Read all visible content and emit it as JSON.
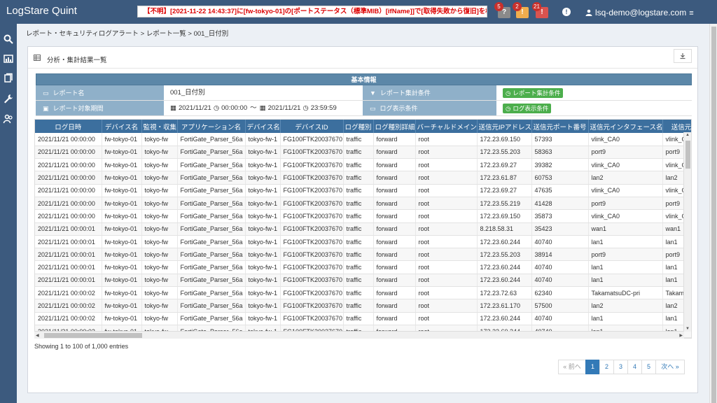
{
  "app": {
    "title": "LogStare Quint",
    "alert": "【不明】[2021-11-22 14:43:37]に[fw-tokyo-01]の[ポートステータス（標準MIB）[ifName]]で[取得失敗から復旧]を検知し",
    "user": "lsq-demo@logstare.com"
  },
  "notifications": [
    {
      "count": "5",
      "symbol": "?",
      "color": "#8a8a8a"
    },
    {
      "count": "2",
      "symbol": "!",
      "color": "#f0ad4e"
    },
    {
      "count": "21",
      "symbol": "!",
      "color": "#d9534f"
    }
  ],
  "breadcrumb": "レポート・セキュリティログアラート > レポート一覧 > 001_日付別",
  "panel": {
    "title": "分析・集計結果一覧"
  },
  "info": {
    "heading": "基本情報",
    "report_name_label": "レポート名",
    "report_name": "001_日付別",
    "period_label": "レポート対象期間",
    "period_from_date": "2021/11/21",
    "period_from_time": "00:00:00",
    "period_sep": "～",
    "period_to_date": "2021/11/21",
    "period_to_time": "23:59:59",
    "aggregate_label": "レポート集計条件",
    "aggregate_btn": "レポート集計条件",
    "display_label": "ログ表示条件",
    "display_btn": "ログ表示条件"
  },
  "grid": {
    "columns": [
      "ログ日時",
      "デバイス名",
      "監視・収集",
      "アプリケーション名",
      "デバイス名",
      "デバイスID",
      "ログ種別",
      "ログ種別詳細",
      "バーチャルドメイン",
      "送信元IPアドレス",
      "送信元ポート番号",
      "送信元インタフェース名",
      "送信元ゾーン"
    ],
    "rows": [
      [
        "2021/11/21 00:00:00",
        "fw-tokyo-01",
        "tokyo-fw",
        "FortiGate_Parser_56a",
        "tokyo-fw-1",
        "FG100FTK20037670",
        "traffic",
        "forward",
        "root",
        "172.23.69.150",
        "57393",
        "vlink_CA0",
        "vlink_C"
      ],
      [
        "2021/11/21 00:00:00",
        "fw-tokyo-01",
        "tokyo-fw",
        "FortiGate_Parser_56a",
        "tokyo-fw-1",
        "FG100FTK20037670",
        "traffic",
        "forward",
        "root",
        "172.23.55.203",
        "58363",
        "port9",
        "port9"
      ],
      [
        "2021/11/21 00:00:00",
        "fw-tokyo-01",
        "tokyo-fw",
        "FortiGate_Parser_56a",
        "tokyo-fw-1",
        "FG100FTK20037670",
        "traffic",
        "forward",
        "root",
        "172.23.69.27",
        "39382",
        "vlink_CA0",
        "vlink_C"
      ],
      [
        "2021/11/21 00:00:00",
        "fw-tokyo-01",
        "tokyo-fw",
        "FortiGate_Parser_56a",
        "tokyo-fw-1",
        "FG100FTK20037670",
        "traffic",
        "forward",
        "root",
        "172.23.61.87",
        "60753",
        "lan2",
        "lan2"
      ],
      [
        "2021/11/21 00:00:00",
        "fw-tokyo-01",
        "tokyo-fw",
        "FortiGate_Parser_56a",
        "tokyo-fw-1",
        "FG100FTK20037670",
        "traffic",
        "forward",
        "root",
        "172.23.69.27",
        "47635",
        "vlink_CA0",
        "vlink_C"
      ],
      [
        "2021/11/21 00:00:00",
        "fw-tokyo-01",
        "tokyo-fw",
        "FortiGate_Parser_56a",
        "tokyo-fw-1",
        "FG100FTK20037670",
        "traffic",
        "forward",
        "root",
        "172.23.55.219",
        "41428",
        "port9",
        "port9"
      ],
      [
        "2021/11/21 00:00:00",
        "fw-tokyo-01",
        "tokyo-fw",
        "FortiGate_Parser_56a",
        "tokyo-fw-1",
        "FG100FTK20037670",
        "traffic",
        "forward",
        "root",
        "172.23.69.150",
        "35873",
        "vlink_CA0",
        "vlink_C"
      ],
      [
        "2021/11/21 00:00:01",
        "fw-tokyo-01",
        "tokyo-fw",
        "FortiGate_Parser_56a",
        "tokyo-fw-1",
        "FG100FTK20037670",
        "traffic",
        "forward",
        "root",
        "8.218.58.31",
        "35423",
        "wan1",
        "wan1"
      ],
      [
        "2021/11/21 00:00:01",
        "fw-tokyo-01",
        "tokyo-fw",
        "FortiGate_Parser_56a",
        "tokyo-fw-1",
        "FG100FTK20037670",
        "traffic",
        "forward",
        "root",
        "172.23.60.244",
        "40740",
        "lan1",
        "lan1"
      ],
      [
        "2021/11/21 00:00:01",
        "fw-tokyo-01",
        "tokyo-fw",
        "FortiGate_Parser_56a",
        "tokyo-fw-1",
        "FG100FTK20037670",
        "traffic",
        "forward",
        "root",
        "172.23.55.203",
        "38914",
        "port9",
        "port9"
      ],
      [
        "2021/11/21 00:00:01",
        "fw-tokyo-01",
        "tokyo-fw",
        "FortiGate_Parser_56a",
        "tokyo-fw-1",
        "FG100FTK20037670",
        "traffic",
        "forward",
        "root",
        "172.23.60.244",
        "40740",
        "lan1",
        "lan1"
      ],
      [
        "2021/11/21 00:00:01",
        "fw-tokyo-01",
        "tokyo-fw",
        "FortiGate_Parser_56a",
        "tokyo-fw-1",
        "FG100FTK20037670",
        "traffic",
        "forward",
        "root",
        "172.23.60.244",
        "40740",
        "lan1",
        "lan1"
      ],
      [
        "2021/11/21 00:00:02",
        "fw-tokyo-01",
        "tokyo-fw",
        "FortiGate_Parser_56a",
        "tokyo-fw-1",
        "FG100FTK20037670",
        "traffic",
        "forward",
        "root",
        "172.23.72.63",
        "62340",
        "TakamatsuDC-pri",
        "Takama"
      ],
      [
        "2021/11/21 00:00:02",
        "fw-tokyo-01",
        "tokyo-fw",
        "FortiGate_Parser_56a",
        "tokyo-fw-1",
        "FG100FTK20037670",
        "traffic",
        "forward",
        "root",
        "172.23.61.170",
        "57500",
        "lan2",
        "lan2"
      ],
      [
        "2021/11/21 00:00:02",
        "fw-tokyo-01",
        "tokyo-fw",
        "FortiGate_Parser_56a",
        "tokyo-fw-1",
        "FG100FTK20037670",
        "traffic",
        "forward",
        "root",
        "172.23.60.244",
        "40740",
        "lan1",
        "lan1"
      ],
      [
        "2021/11/21 00:00:02",
        "fw-tokyo-01",
        "tokyo-fw",
        "FortiGate_Parser_56a",
        "tokyo-fw-1",
        "FG100FTK20037670",
        "traffic",
        "forward",
        "root",
        "172.23.60.244",
        "40740",
        "lan1",
        "lan1"
      ]
    ]
  },
  "entries_text": "Showing 1 to 100 of 1,000 entries",
  "pagination": {
    "prev": "« 前へ",
    "pages": [
      "1",
      "2",
      "3",
      "4",
      "5"
    ],
    "active": "1",
    "next": "次へ »"
  }
}
